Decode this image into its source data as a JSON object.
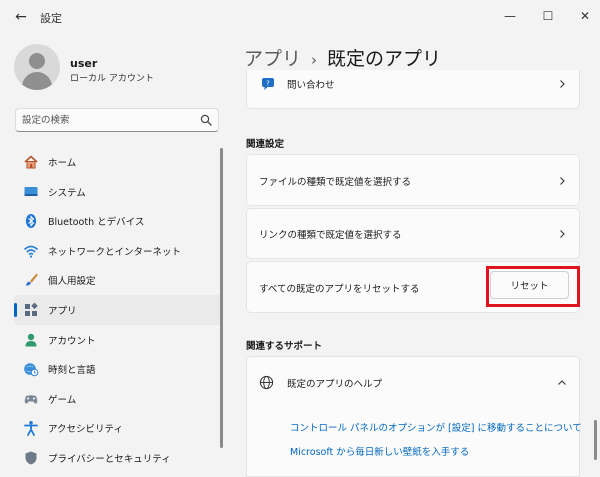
{
  "window": {
    "title": "設定",
    "back_glyph": "←",
    "min_glyph": "—",
    "max_glyph": "☐",
    "close_glyph": "✕"
  },
  "profile": {
    "name": "user",
    "account_type": "ローカル アカウント"
  },
  "search": {
    "placeholder": "設定の検索"
  },
  "nav": {
    "items": [
      {
        "label": "ホーム",
        "icon": "home-icon"
      },
      {
        "label": "システム",
        "icon": "system-icon"
      },
      {
        "label": "Bluetooth とデバイス",
        "icon": "bluetooth-icon"
      },
      {
        "label": "ネットワークとインターネット",
        "icon": "wifi-icon"
      },
      {
        "label": "個人用設定",
        "icon": "brush-icon"
      },
      {
        "label": "アプリ",
        "icon": "apps-icon",
        "active": true
      },
      {
        "label": "アカウント",
        "icon": "account-icon"
      },
      {
        "label": "時刻と言語",
        "icon": "globe-clock-icon"
      },
      {
        "label": "ゲーム",
        "icon": "gamepad-icon"
      },
      {
        "label": "アクセシビリティ",
        "icon": "accessibility-icon"
      },
      {
        "label": "プライバシーとセキュリティ",
        "icon": "shield-icon"
      }
    ]
  },
  "breadcrumb": {
    "parent": "アプリ",
    "separator": "›",
    "current": "既定のアプリ"
  },
  "main": {
    "contact_card": {
      "label": "問い合わせ"
    },
    "related_settings": {
      "title": "関連設定",
      "items": [
        {
          "label": "ファイルの種類で既定値を選択する"
        },
        {
          "label": "リンクの種類で既定値を選択する"
        }
      ],
      "reset": {
        "label": "すべての既定のアプリをリセットする",
        "button_label": "リセット"
      }
    },
    "related_support": {
      "title": "関連するサポート",
      "help_title": "既定のアプリのヘルプ",
      "links": [
        "コントロール パネルのオプションが [設定] に移動することについて",
        "Microsoft から毎日新しい壁紙を入手する"
      ]
    }
  },
  "colors": {
    "accent": "#0067c0",
    "highlight": "#e0141e"
  }
}
